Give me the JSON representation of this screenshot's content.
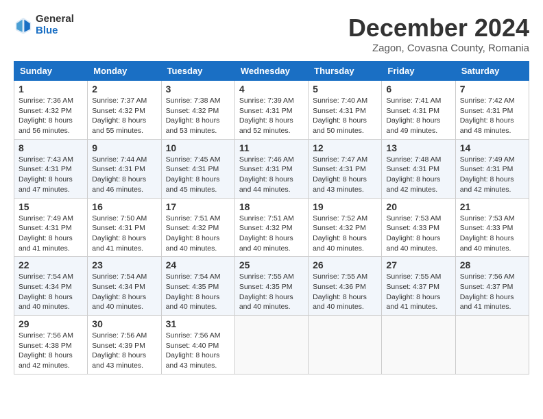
{
  "logo": {
    "general": "General",
    "blue": "Blue"
  },
  "title": "December 2024",
  "subtitle": "Zagon, Covasna County, Romania",
  "days_of_week": [
    "Sunday",
    "Monday",
    "Tuesday",
    "Wednesday",
    "Thursday",
    "Friday",
    "Saturday"
  ],
  "weeks": [
    [
      {
        "day": "1",
        "sunrise": "7:36 AM",
        "sunset": "4:32 PM",
        "daylight": "8 hours and 56 minutes."
      },
      {
        "day": "2",
        "sunrise": "7:37 AM",
        "sunset": "4:32 PM",
        "daylight": "8 hours and 55 minutes."
      },
      {
        "day": "3",
        "sunrise": "7:38 AM",
        "sunset": "4:32 PM",
        "daylight": "8 hours and 53 minutes."
      },
      {
        "day": "4",
        "sunrise": "7:39 AM",
        "sunset": "4:31 PM",
        "daylight": "8 hours and 52 minutes."
      },
      {
        "day": "5",
        "sunrise": "7:40 AM",
        "sunset": "4:31 PM",
        "daylight": "8 hours and 50 minutes."
      },
      {
        "day": "6",
        "sunrise": "7:41 AM",
        "sunset": "4:31 PM",
        "daylight": "8 hours and 49 minutes."
      },
      {
        "day": "7",
        "sunrise": "7:42 AM",
        "sunset": "4:31 PM",
        "daylight": "8 hours and 48 minutes."
      }
    ],
    [
      {
        "day": "8",
        "sunrise": "7:43 AM",
        "sunset": "4:31 PM",
        "daylight": "8 hours and 47 minutes."
      },
      {
        "day": "9",
        "sunrise": "7:44 AM",
        "sunset": "4:31 PM",
        "daylight": "8 hours and 46 minutes."
      },
      {
        "day": "10",
        "sunrise": "7:45 AM",
        "sunset": "4:31 PM",
        "daylight": "8 hours and 45 minutes."
      },
      {
        "day": "11",
        "sunrise": "7:46 AM",
        "sunset": "4:31 PM",
        "daylight": "8 hours and 44 minutes."
      },
      {
        "day": "12",
        "sunrise": "7:47 AM",
        "sunset": "4:31 PM",
        "daylight": "8 hours and 43 minutes."
      },
      {
        "day": "13",
        "sunrise": "7:48 AM",
        "sunset": "4:31 PM",
        "daylight": "8 hours and 42 minutes."
      },
      {
        "day": "14",
        "sunrise": "7:49 AM",
        "sunset": "4:31 PM",
        "daylight": "8 hours and 42 minutes."
      }
    ],
    [
      {
        "day": "15",
        "sunrise": "7:49 AM",
        "sunset": "4:31 PM",
        "daylight": "8 hours and 41 minutes."
      },
      {
        "day": "16",
        "sunrise": "7:50 AM",
        "sunset": "4:31 PM",
        "daylight": "8 hours and 41 minutes."
      },
      {
        "day": "17",
        "sunrise": "7:51 AM",
        "sunset": "4:32 PM",
        "daylight": "8 hours and 40 minutes."
      },
      {
        "day": "18",
        "sunrise": "7:51 AM",
        "sunset": "4:32 PM",
        "daylight": "8 hours and 40 minutes."
      },
      {
        "day": "19",
        "sunrise": "7:52 AM",
        "sunset": "4:32 PM",
        "daylight": "8 hours and 40 minutes."
      },
      {
        "day": "20",
        "sunrise": "7:53 AM",
        "sunset": "4:33 PM",
        "daylight": "8 hours and 40 minutes."
      },
      {
        "day": "21",
        "sunrise": "7:53 AM",
        "sunset": "4:33 PM",
        "daylight": "8 hours and 40 minutes."
      }
    ],
    [
      {
        "day": "22",
        "sunrise": "7:54 AM",
        "sunset": "4:34 PM",
        "daylight": "8 hours and 40 minutes."
      },
      {
        "day": "23",
        "sunrise": "7:54 AM",
        "sunset": "4:34 PM",
        "daylight": "8 hours and 40 minutes."
      },
      {
        "day": "24",
        "sunrise": "7:54 AM",
        "sunset": "4:35 PM",
        "daylight": "8 hours and 40 minutes."
      },
      {
        "day": "25",
        "sunrise": "7:55 AM",
        "sunset": "4:35 PM",
        "daylight": "8 hours and 40 minutes."
      },
      {
        "day": "26",
        "sunrise": "7:55 AM",
        "sunset": "4:36 PM",
        "daylight": "8 hours and 40 minutes."
      },
      {
        "day": "27",
        "sunrise": "7:55 AM",
        "sunset": "4:37 PM",
        "daylight": "8 hours and 41 minutes."
      },
      {
        "day": "28",
        "sunrise": "7:56 AM",
        "sunset": "4:37 PM",
        "daylight": "8 hours and 41 minutes."
      }
    ],
    [
      {
        "day": "29",
        "sunrise": "7:56 AM",
        "sunset": "4:38 PM",
        "daylight": "8 hours and 42 minutes."
      },
      {
        "day": "30",
        "sunrise": "7:56 AM",
        "sunset": "4:39 PM",
        "daylight": "8 hours and 43 minutes."
      },
      {
        "day": "31",
        "sunrise": "7:56 AM",
        "sunset": "4:40 PM",
        "daylight": "8 hours and 43 minutes."
      },
      null,
      null,
      null,
      null
    ]
  ]
}
